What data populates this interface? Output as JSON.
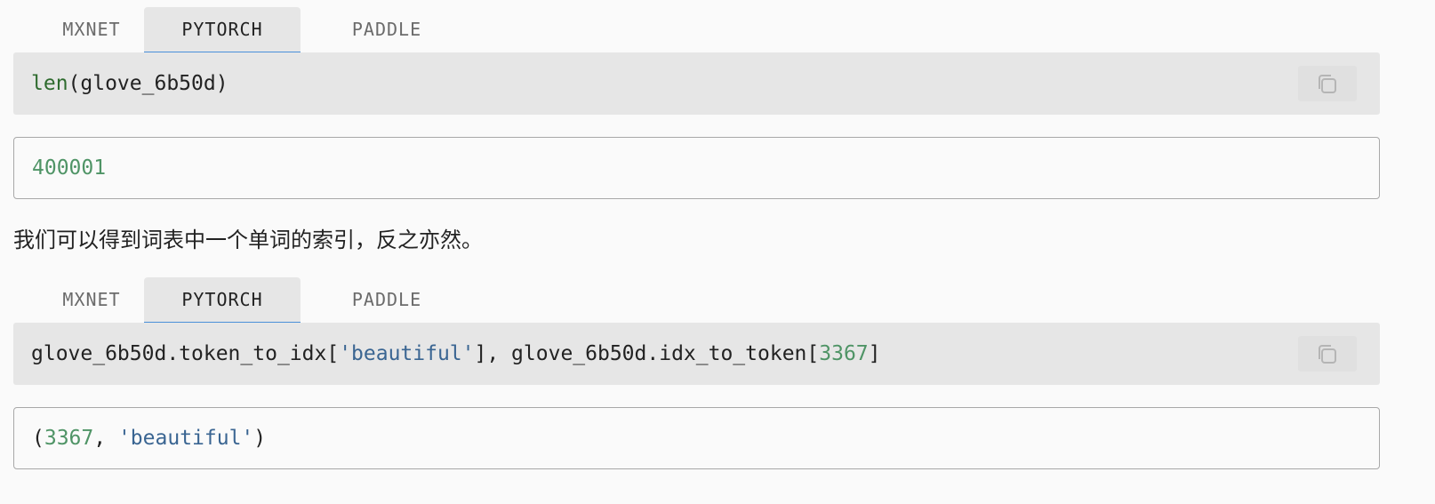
{
  "block1": {
    "tabs": [
      "MXNET",
      "PYTORCH",
      "PADDLE"
    ],
    "active_tab": "PYTORCH",
    "code": {
      "fn": "len",
      "rest": "(glove_6b50d)"
    },
    "output": "400001"
  },
  "paragraph": "我们可以得到词表中一个单词的索引，反之亦然。",
  "block2": {
    "tabs": [
      "MXNET",
      "PYTORCH",
      "PADDLE"
    ],
    "active_tab": "PYTORCH",
    "code": {
      "part1": "glove_6b50d.token_to_idx[",
      "str": "'beautiful'",
      "part2": "], glove_6b50d.idx_to_token[",
      "num": "3367",
      "part3": "]"
    },
    "output": {
      "open": "(",
      "num": "3367",
      "sep": ", ",
      "str": "'beautiful'",
      "close": ")"
    }
  },
  "icons": {
    "copy": "copy-icon"
  },
  "colors": {
    "tab_underline": "#4a90d9",
    "code_bg": "#e6e6e6",
    "string": "#3a6592",
    "number": "#4f9466",
    "builtin": "#2e6b2e"
  }
}
